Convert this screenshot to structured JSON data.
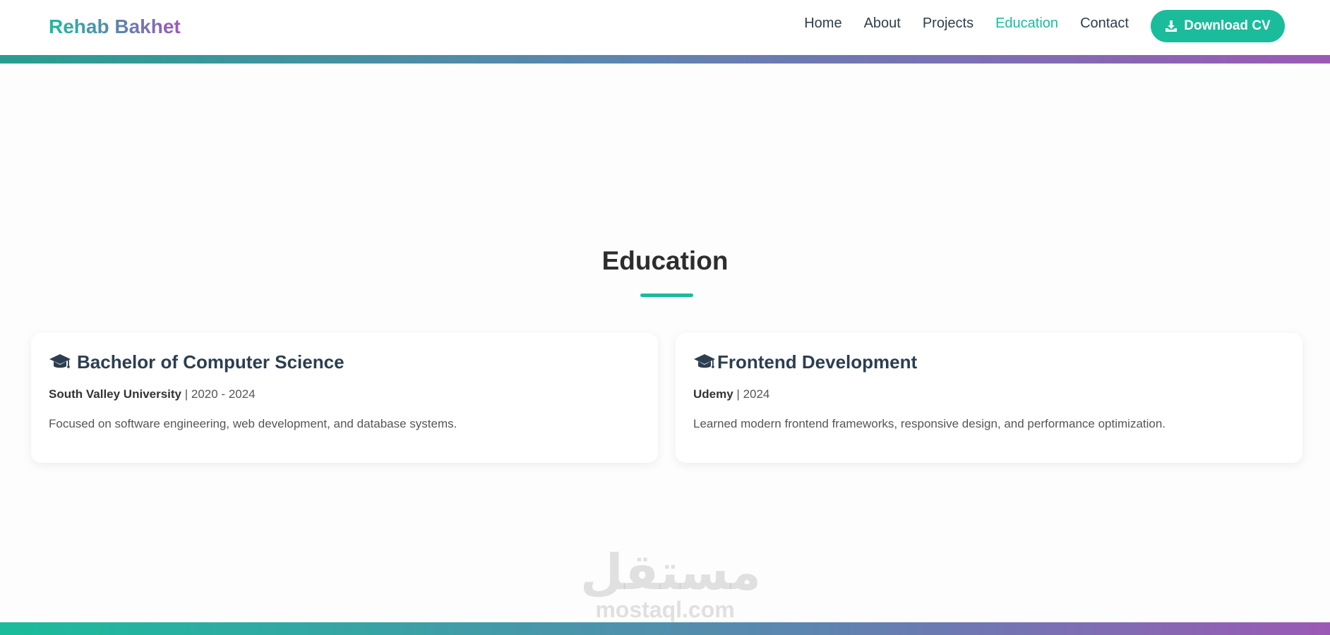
{
  "header": {
    "logo": "Rehab Bakhet",
    "nav": [
      "Home",
      "About",
      "Projects",
      "Education",
      "Contact"
    ],
    "active_nav": "Education",
    "cv_button": "Download CV",
    "cv_icon": "download-icon"
  },
  "education": {
    "title": "Education",
    "cards": [
      {
        "icon": "graduation-cap-icon",
        "title": "Bachelor of Computer Science",
        "org": "South Valley University",
        "sep": " | ",
        "period": "2020 - 2024",
        "description": "Focused on software engineering, web development, and database systems."
      },
      {
        "icon": "graduation-cap-icon",
        "title": "Frontend Development",
        "org": "Udemy",
        "sep": " | ",
        "period": "2024",
        "description": "Learned modern frontend frameworks, responsive design, and performance optimization."
      }
    ]
  },
  "watermark": {
    "arabic": "مستقل",
    "latin": "mostaql.com"
  },
  "colors": {
    "accent": "#1abc9c",
    "purple": "#9b59b6",
    "text": "#2c3e50"
  }
}
